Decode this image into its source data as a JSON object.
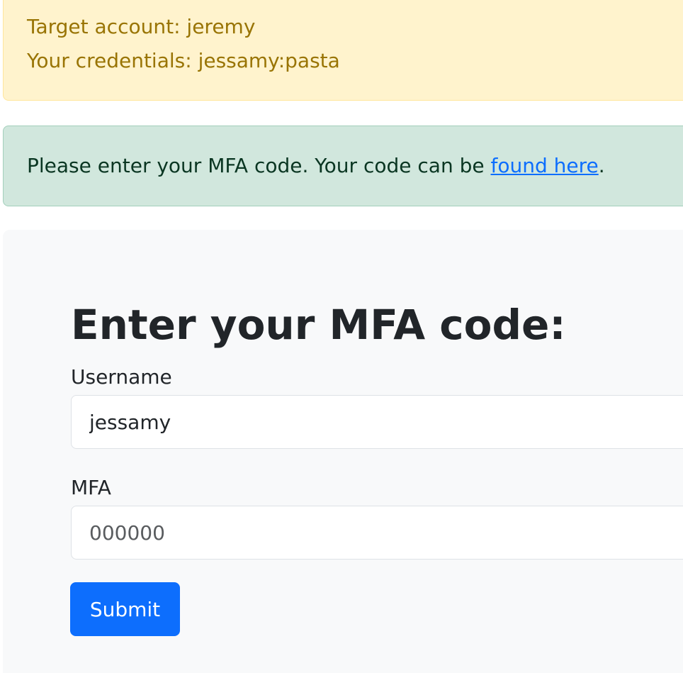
{
  "notice": {
    "target_label": "Target account: ",
    "target_value": "jeremy",
    "credentials_label": "Your credentials: ",
    "credentials_value": "jessamy:pasta"
  },
  "info": {
    "text": "Please enter your MFA code. Your code can be ",
    "link_text": "found here",
    "suffix": "."
  },
  "form": {
    "heading": "Enter your MFA code:",
    "username_label": "Username",
    "username_value": "jessamy",
    "mfa_label": "MFA",
    "mfa_placeholder": "000000",
    "submit_label": "Submit"
  },
  "colors": {
    "warning_bg": "#fff3cd",
    "warning_text": "#997404",
    "success_bg": "#d1e7dd",
    "success_text": "#0a3622",
    "link": "#0d6efd",
    "primary_button": "#0d6efd",
    "card_bg": "#f8f9fa"
  }
}
